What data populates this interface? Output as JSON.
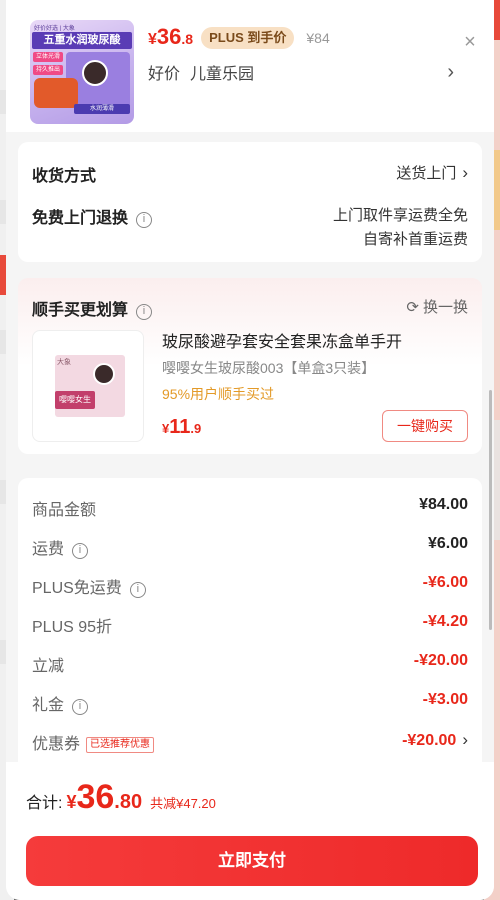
{
  "header": {
    "thumb": {
      "top_text": "好价好选 | 大象",
      "title": "五重水润玻尿酸",
      "tags": [
        "立体光滑",
        "持久推出"
      ],
      "bottom_text": "水润薄滑"
    },
    "price": {
      "currency": "¥",
      "integer": "36",
      "decimal": ".8"
    },
    "plus_badge": "PLUS 到手价",
    "original_price": "¥84",
    "close_icon": "×",
    "shop": {
      "tag": "好价",
      "name": "儿童乐园",
      "arrow": "›"
    }
  },
  "delivery": {
    "method_label": "收货方式",
    "method_value": "送货上门",
    "return_label": "免费上门退换",
    "return_value_line1": "上门取件享运费全免",
    "return_value_line2": "自寄补首重运费",
    "chevron": "›",
    "info": "i"
  },
  "addon": {
    "title": "顺手买更划算",
    "swap_label": "换一换",
    "swap_icon": "⟳",
    "product_name": "玻尿酸避孕套安全套果冻盒单手开",
    "product_spec": "嘤嘤女生玻尿酸003【单盒3只装】",
    "rate_text": "95%用户顺手买过",
    "price": {
      "currency": "¥",
      "integer": "11",
      "decimal": ".9"
    },
    "buy_label": "一键购买",
    "thumb": {
      "brand": "大象",
      "band": "嘤嘤女生"
    }
  },
  "summary": {
    "rows": [
      {
        "label": "商品金额",
        "value": "¥84.00",
        "info": false,
        "red": false
      },
      {
        "label": "运费",
        "value": "¥6.00",
        "info": true,
        "red": false
      },
      {
        "label": "PLUS免运费",
        "value": "-¥6.00",
        "info": true,
        "red": true
      },
      {
        "label": "PLUS 95折",
        "value": "-¥4.20",
        "info": false,
        "red": true
      },
      {
        "label": "立减",
        "value": "-¥20.00",
        "info": false,
        "red": true
      },
      {
        "label": "礼金",
        "value": "-¥3.00",
        "info": true,
        "red": true
      },
      {
        "label": "优惠券",
        "value": "-¥20.00",
        "info": false,
        "red": true,
        "tag": "已选推荐优惠",
        "chevron": "›"
      }
    ]
  },
  "footer": {
    "total_label": "合计:",
    "total_price": {
      "currency": "¥",
      "integer": "36",
      "decimal": ".80"
    },
    "total_save": "共减¥47.20",
    "pay_label": "立即支付"
  },
  "colors": {
    "accent": "#e8271a",
    "pay_button": "#f53b3b",
    "plus_badge_bg": "#f8e0c4",
    "rate": "#e39a28"
  }
}
